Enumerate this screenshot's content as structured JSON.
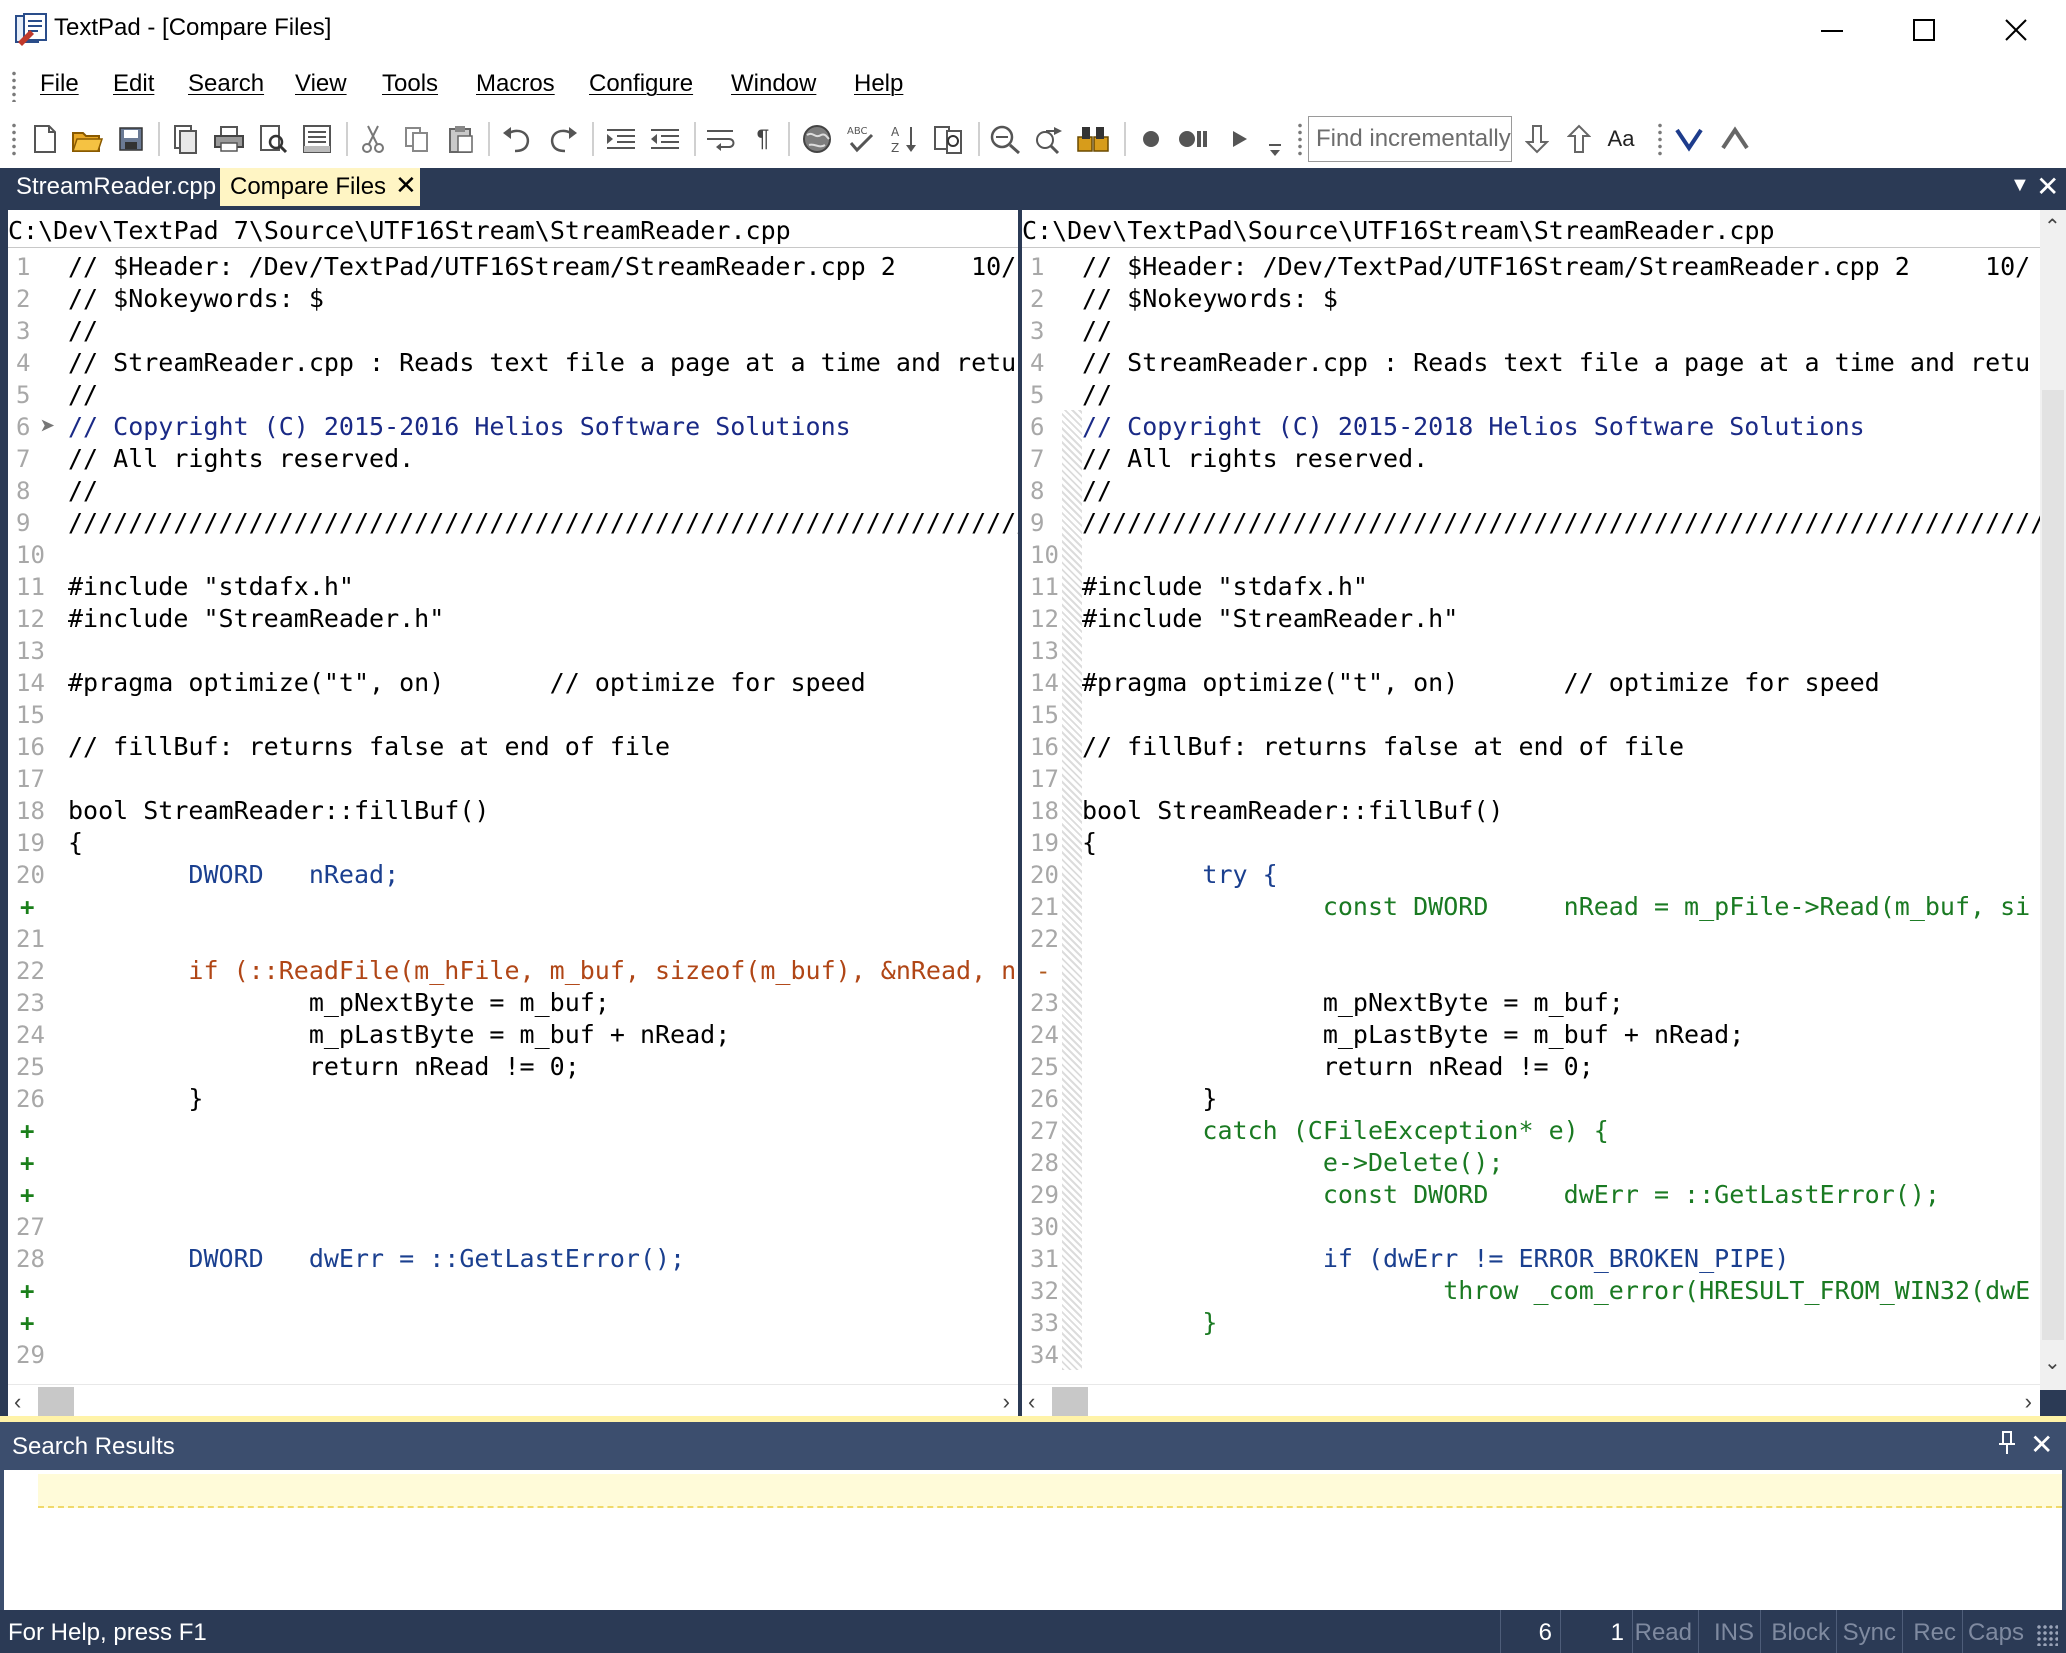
{
  "window": {
    "title": "TextPad - [Compare Files]"
  },
  "menu": {
    "items": [
      "File",
      "Edit",
      "Search",
      "View",
      "Tools",
      "Macros",
      "Configure",
      "Window",
      "Help"
    ]
  },
  "toolbar": {
    "icons": [
      "new-file-icon",
      "open-folder-icon",
      "save-icon",
      "copy-file-icon",
      "print-icon",
      "print-preview-icon",
      "document-properties-icon",
      "cut-icon",
      "copy-icon",
      "paste-icon",
      "undo-icon",
      "redo-icon",
      "indent-icon",
      "outdent-icon",
      "word-wrap-icon",
      "pilcrow-icon",
      "web-icon",
      "spell-check-icon",
      "sort-icon",
      "compare-icon",
      "find-icon",
      "replace-icon",
      "find-in-files-icon",
      "record-macro-icon",
      "pause-macro-icon",
      "play-macro-icon",
      "toolbar-options-icon"
    ],
    "find_placeholder": "Find incrementally",
    "find_options": [
      "find-next-down-icon",
      "find-previous-up-icon",
      "match-case-icon",
      "mark-next-icon",
      "mark-previous-icon"
    ]
  },
  "tabs": [
    {
      "label": "StreamReader.cpp",
      "active": false
    },
    {
      "label": "Compare Files",
      "active": true
    }
  ],
  "compare": {
    "left": {
      "path": "C:\\Dev\\TextPad 7\\Source\\UTF16Stream\\StreamReader.cpp",
      "lines": [
        {
          "num": "1",
          "text": "// $Header: /Dev/TextPad/UTF16Stream/StreamReader.cpp 2     10/",
          "cls": "c-comment"
        },
        {
          "num": "2",
          "text": "// $Nokeywords: $",
          "cls": "c-comment"
        },
        {
          "num": "3",
          "text": "//",
          "cls": "c-comment"
        },
        {
          "num": "4",
          "text": "// StreamReader.cpp : Reads text file a page at a time and retu",
          "cls": "c-comment"
        },
        {
          "num": "5",
          "text": "//",
          "cls": "c-comment"
        },
        {
          "num": "6",
          "text": "// Copyright (C) 2015-2016 Helios Software Solutions",
          "cls": "c-copy",
          "marker": true
        },
        {
          "num": "7",
          "text": "// All rights reserved.",
          "cls": "c-comment"
        },
        {
          "num": "8",
          "text": "//",
          "cls": "c-comment"
        },
        {
          "num": "9",
          "text": "////////////////////////////////////////////////////////////////",
          "cls": "c-comment"
        },
        {
          "num": "10",
          "text": "",
          "cls": "c-comment"
        },
        {
          "num": "11",
          "text": "#include \"stdafx.h\"",
          "cls": "c-comment"
        },
        {
          "num": "12",
          "text": "#include \"StreamReader.h\"",
          "cls": "c-comment"
        },
        {
          "num": "13",
          "text": "",
          "cls": "c-comment"
        },
        {
          "num": "14",
          "text": "#pragma optimize(\"t\", on)       // optimize for speed",
          "cls": "c-comment"
        },
        {
          "num": "15",
          "text": "",
          "cls": "c-comment"
        },
        {
          "num": "16",
          "text": "// fillBuf: returns false at end of file",
          "cls": "c-comment"
        },
        {
          "num": "17",
          "text": "",
          "cls": "c-comment"
        },
        {
          "num": "18",
          "text": "bool StreamReader::fillBuf()",
          "cls": "c-comment"
        },
        {
          "num": "19",
          "text": "{",
          "cls": "c-comment"
        },
        {
          "num": "20",
          "text": "        DWORD   nRead;",
          "cls": "c-changed"
        },
        {
          "num": "+",
          "text": "",
          "cls": "c-comment",
          "kind": "plus"
        },
        {
          "num": "21",
          "text": "",
          "cls": "c-comment"
        },
        {
          "num": "22",
          "text": "        if (::ReadFile(m_hFile, m_buf, sizeof(m_buf), &nRead, n",
          "cls": "c-removed"
        },
        {
          "num": "23",
          "text": "                m_pNextByte = m_buf;",
          "cls": "c-comment"
        },
        {
          "num": "24",
          "text": "                m_pLastByte = m_buf + nRead;",
          "cls": "c-comment"
        },
        {
          "num": "25",
          "text": "                return nRead != 0;",
          "cls": "c-comment"
        },
        {
          "num": "26",
          "text": "        }",
          "cls": "c-comment"
        },
        {
          "num": "+",
          "text": "",
          "cls": "c-comment",
          "kind": "plus"
        },
        {
          "num": "+",
          "text": "",
          "cls": "c-comment",
          "kind": "plus"
        },
        {
          "num": "+",
          "text": "",
          "cls": "c-comment",
          "kind": "plus"
        },
        {
          "num": "27",
          "text": "",
          "cls": "c-comment"
        },
        {
          "num": "28",
          "text": "        DWORD   dwErr = ::GetLastError();",
          "cls": "c-changed"
        },
        {
          "num": "+",
          "text": "",
          "cls": "c-comment",
          "kind": "plus"
        },
        {
          "num": "+",
          "text": "",
          "cls": "c-comment",
          "kind": "plus"
        },
        {
          "num": "29",
          "text": "",
          "cls": "c-comment"
        }
      ]
    },
    "right": {
      "path": "C:\\Dev\\TextPad\\Source\\UTF16Stream\\StreamReader.cpp",
      "lines": [
        {
          "num": "1",
          "text": "// $Header: /Dev/TextPad/UTF16Stream/StreamReader.cpp 2     10/",
          "cls": "c-comment"
        },
        {
          "num": "2",
          "text": "// $Nokeywords: $",
          "cls": "c-comment"
        },
        {
          "num": "3",
          "text": "//",
          "cls": "c-comment"
        },
        {
          "num": "4",
          "text": "// StreamReader.cpp : Reads text file a page at a time and retu",
          "cls": "c-comment"
        },
        {
          "num": "5",
          "text": "//",
          "cls": "c-comment"
        },
        {
          "num": "6",
          "text": "// Copyright (C) 2015-2018 Helios Software Solutions",
          "cls": "c-copy"
        },
        {
          "num": "7",
          "text": "// All rights reserved.",
          "cls": "c-comment"
        },
        {
          "num": "8",
          "text": "//",
          "cls": "c-comment"
        },
        {
          "num": "9",
          "text": "////////////////////////////////////////////////////////////////",
          "cls": "c-comment"
        },
        {
          "num": "10",
          "text": "",
          "cls": "c-comment"
        },
        {
          "num": "11",
          "text": "#include \"stdafx.h\"",
          "cls": "c-comment"
        },
        {
          "num": "12",
          "text": "#include \"StreamReader.h\"",
          "cls": "c-comment"
        },
        {
          "num": "13",
          "text": "",
          "cls": "c-comment"
        },
        {
          "num": "14",
          "text": "#pragma optimize(\"t\", on)       // optimize for speed",
          "cls": "c-comment"
        },
        {
          "num": "15",
          "text": "",
          "cls": "c-comment"
        },
        {
          "num": "16",
          "text": "// fillBuf: returns false at end of file",
          "cls": "c-comment"
        },
        {
          "num": "17",
          "text": "",
          "cls": "c-comment"
        },
        {
          "num": "18",
          "text": "bool StreamReader::fillBuf()",
          "cls": "c-comment"
        },
        {
          "num": "19",
          "text": "{",
          "cls": "c-comment"
        },
        {
          "num": "20",
          "text": "        try {",
          "cls": "c-changed"
        },
        {
          "num": "21",
          "text": "                const DWORD     nRead = m_pFile->Read(m_buf, si",
          "cls": "c-added"
        },
        {
          "num": "22",
          "text": "",
          "cls": "c-comment"
        },
        {
          "num": "-",
          "text": "",
          "cls": "c-comment",
          "kind": "minus"
        },
        {
          "num": "23",
          "text": "                m_pNextByte = m_buf;",
          "cls": "c-comment"
        },
        {
          "num": "24",
          "text": "                m_pLastByte = m_buf + nRead;",
          "cls": "c-comment"
        },
        {
          "num": "25",
          "text": "                return nRead != 0;",
          "cls": "c-comment"
        },
        {
          "num": "26",
          "text": "        }",
          "cls": "c-comment"
        },
        {
          "num": "27",
          "text": "        catch (CFileException* e) {",
          "cls": "c-added"
        },
        {
          "num": "28",
          "text": "                e->Delete();",
          "cls": "c-added"
        },
        {
          "num": "29",
          "text": "                const DWORD     dwErr = ::GetLastError();",
          "cls": "c-added"
        },
        {
          "num": "30",
          "text": "",
          "cls": "c-comment"
        },
        {
          "num": "31",
          "text": "                if (dwErr != ERROR_BROKEN_PIPE)",
          "cls": "c-changed"
        },
        {
          "num": "32",
          "text": "                        throw _com_error(HRESULT_FROM_WIN32(dwE",
          "cls": "c-added"
        },
        {
          "num": "33",
          "text": "        }",
          "cls": "c-added"
        },
        {
          "num": "34",
          "text": "",
          "cls": "c-comment"
        }
      ]
    }
  },
  "search_results": {
    "title": "Search Results"
  },
  "status": {
    "help": "For Help, press F1",
    "line": "6",
    "col": "1",
    "flags": [
      "Read",
      "INS",
      "Block",
      "Sync",
      "Rec",
      "Caps"
    ]
  }
}
